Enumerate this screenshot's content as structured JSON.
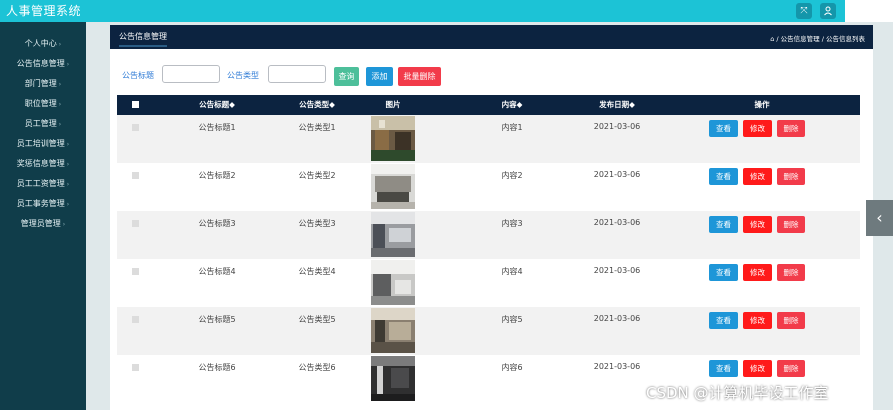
{
  "app": {
    "title": "人事管理系统"
  },
  "topbar": {
    "fullscreen_icon": "expand-icon",
    "user_icon": "user-icon"
  },
  "sidebar": {
    "items": [
      {
        "label": "个人中心"
      },
      {
        "label": "公告信息管理"
      },
      {
        "label": "部门管理"
      },
      {
        "label": "职位管理"
      },
      {
        "label": "员工管理"
      },
      {
        "label": "员工培训管理"
      },
      {
        "label": "奖惩信息管理"
      },
      {
        "label": "员工工资管理"
      },
      {
        "label": "员工事务管理"
      },
      {
        "label": "管理员管理"
      }
    ]
  },
  "panel": {
    "title": "公告信息管理",
    "breadcrumb": "/ 公告信息管理 / 公告信息列表"
  },
  "filters": {
    "title_label": "公告标题",
    "type_label": "公告类型",
    "title_value": "",
    "type_value": ""
  },
  "actions": {
    "query": "查询",
    "add": "添加",
    "batch_delete": "批量删除"
  },
  "table": {
    "columns": [
      "公告标题◆",
      "公告类型◆",
      "图片",
      "内容◆",
      "发布日期◆",
      "操作"
    ],
    "rows": [
      {
        "title": "公告标题1",
        "type": "公告类型1",
        "content": "内容1",
        "date": "2021-03-06"
      },
      {
        "title": "公告标题2",
        "type": "公告类型2",
        "content": "内容2",
        "date": "2021-03-06"
      },
      {
        "title": "公告标题3",
        "type": "公告类型3",
        "content": "内容3",
        "date": "2021-03-06"
      },
      {
        "title": "公告标题4",
        "type": "公告类型4",
        "content": "内容4",
        "date": "2021-03-06"
      },
      {
        "title": "公告标题5",
        "type": "公告类型5",
        "content": "内容5",
        "date": "2021-03-06"
      },
      {
        "title": "公告标题6",
        "type": "公告类型6",
        "content": "内容6",
        "date": "2021-03-06"
      }
    ],
    "row_actions": {
      "view": "查看",
      "edit": "修改",
      "delete": "删除"
    }
  },
  "watermark": "CSDN @计算机毕设工作室",
  "colors": {
    "topbar": "#1cc3d6",
    "sidebar": "#103d4a",
    "header_navy": "#0c2340",
    "query_green": "#4dbf9a",
    "add_blue": "#1e96d8",
    "danger_red": "#f23b4a",
    "edit_red": "#ff1a1a"
  }
}
